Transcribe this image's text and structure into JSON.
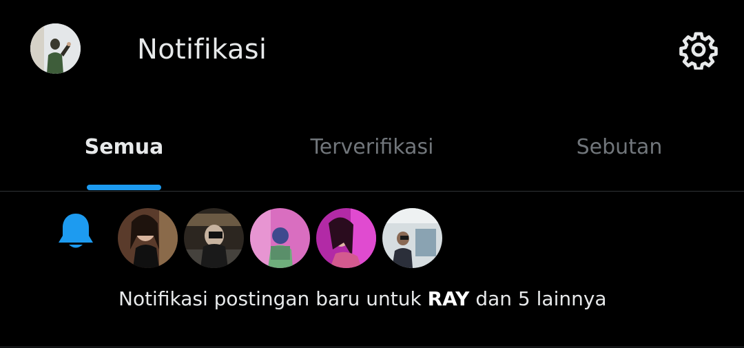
{
  "header": {
    "title": "Notifikasi",
    "settings_icon": "gear-icon",
    "profile_avatar": "profile-avatar"
  },
  "tabs": [
    {
      "label": "Semua",
      "active": true
    },
    {
      "label": "Terverifikasi",
      "active": false
    },
    {
      "label": "Sebutan",
      "active": false
    }
  ],
  "notification": {
    "icon": "bell-icon",
    "text_prefix": "Notifikasi postingan baru untuk ",
    "bold_name": "RAY",
    "text_suffix": " dan 5 lainnya",
    "avatars": [
      "avatar-1",
      "avatar-2",
      "avatar-3",
      "avatar-4",
      "avatar-5"
    ]
  },
  "colors": {
    "accent": "#1d9bf0",
    "background": "#000000",
    "text_primary": "#e7e9ea",
    "text_secondary": "#71767b"
  }
}
